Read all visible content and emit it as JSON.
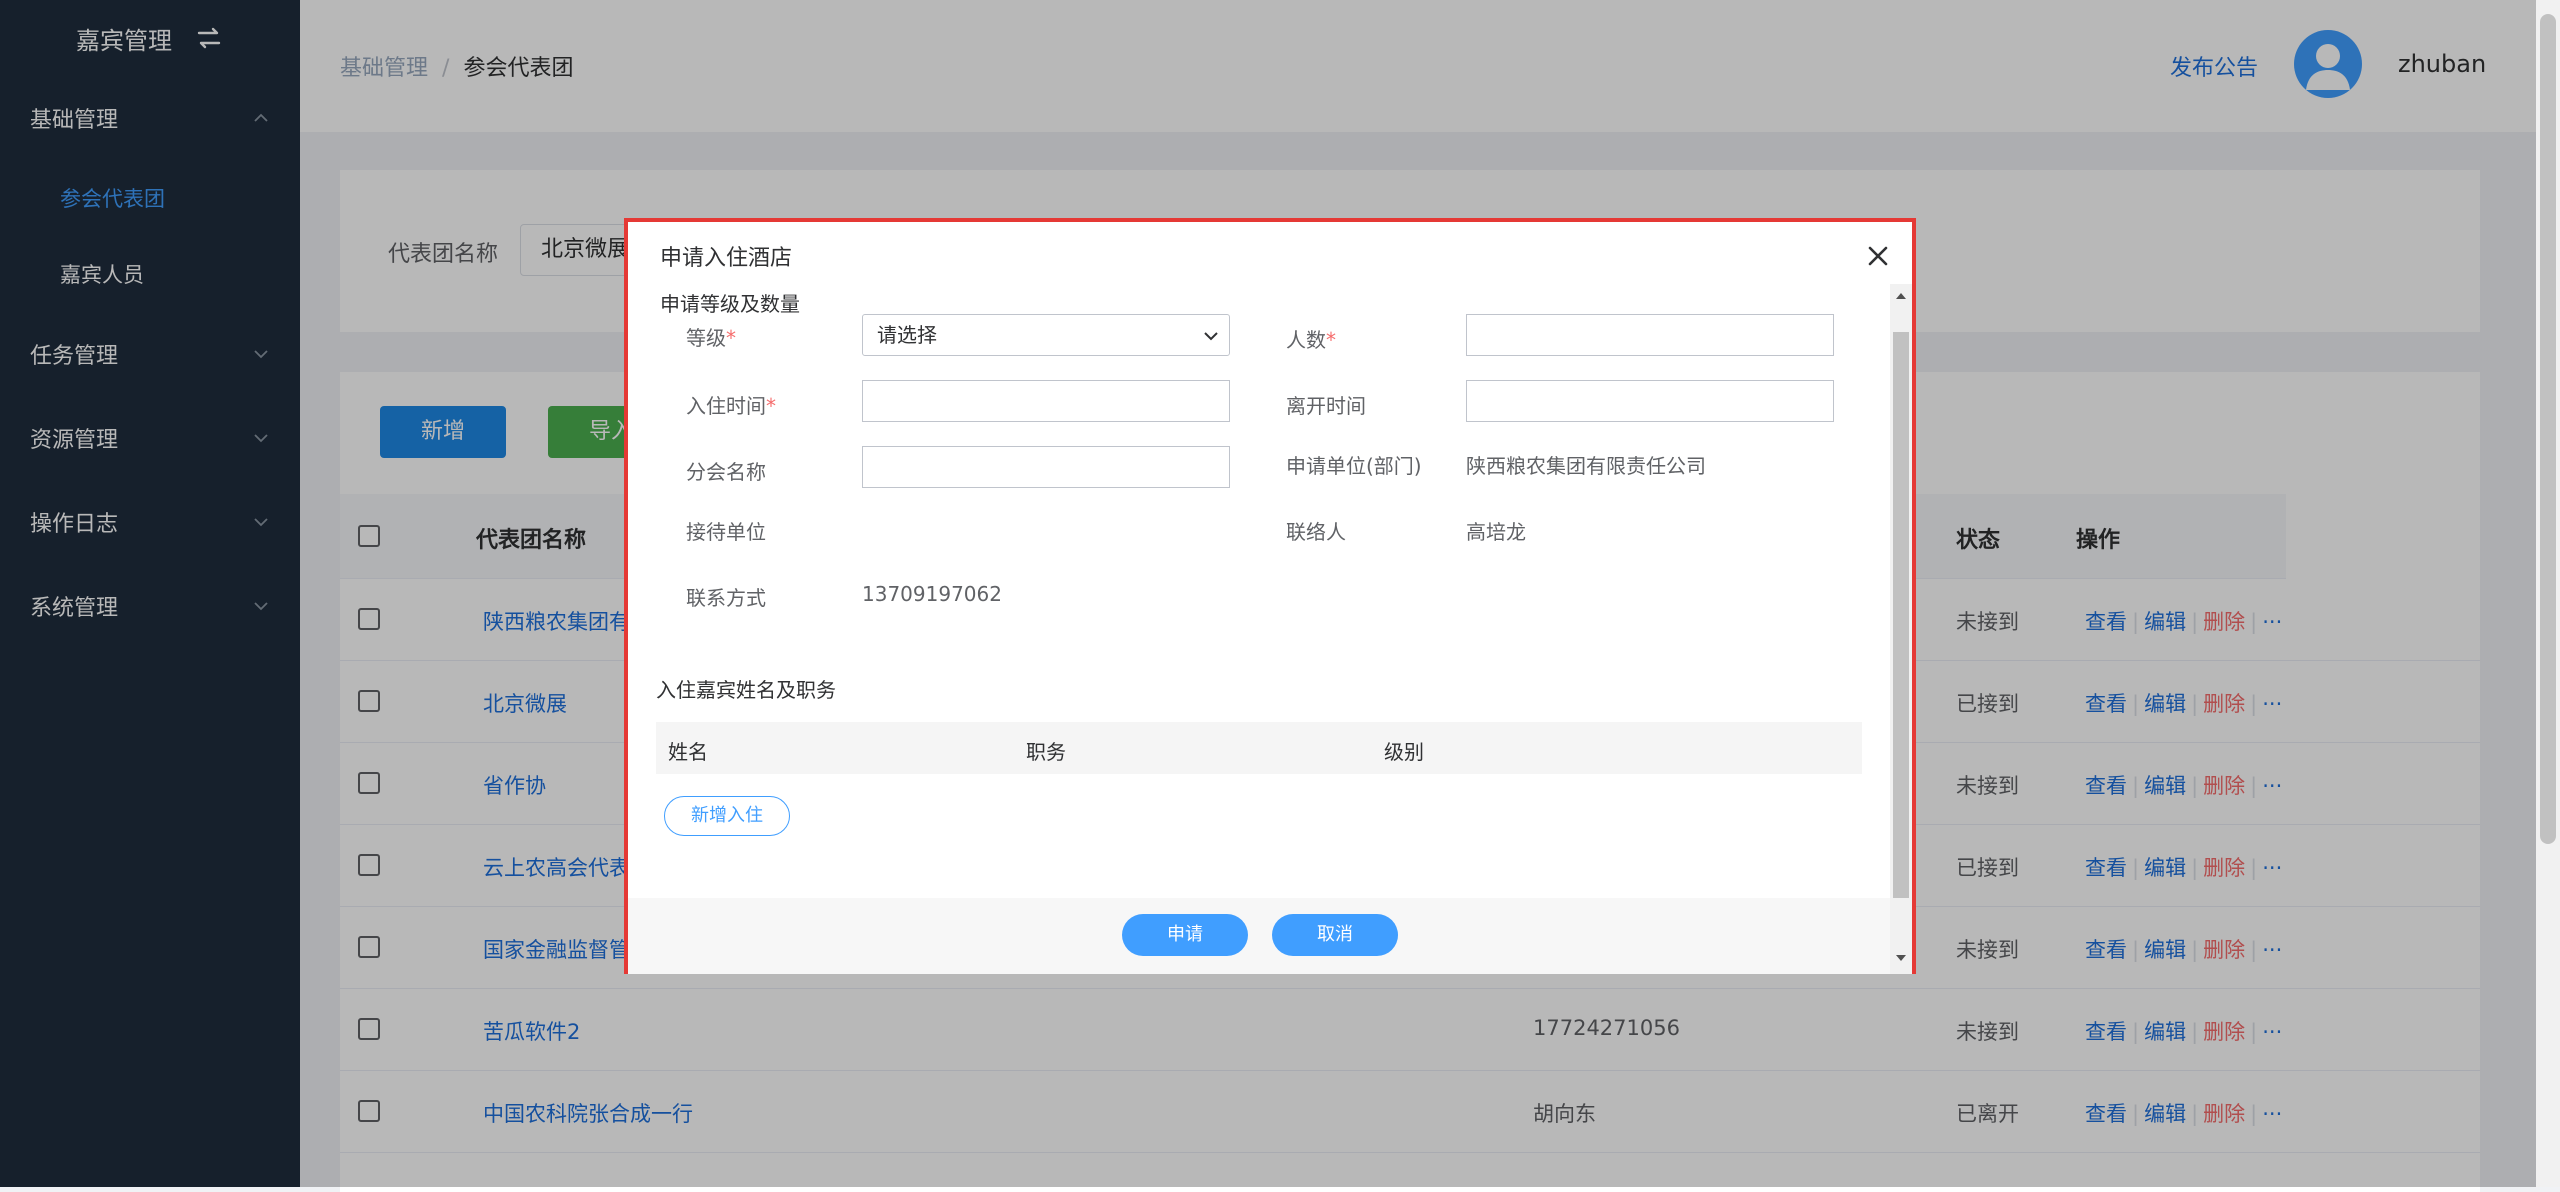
{
  "sidebar": {
    "title": "嘉宾管理",
    "groups": [
      {
        "label": "基础管理",
        "expanded": true,
        "items": [
          {
            "label": "参会代表团",
            "active": true
          },
          {
            "label": "嘉宾人员",
            "active": false
          }
        ]
      },
      {
        "label": "任务管理",
        "expanded": false
      },
      {
        "label": "资源管理",
        "expanded": false
      },
      {
        "label": "操作日志",
        "expanded": false
      },
      {
        "label": "系统管理",
        "expanded": false
      }
    ]
  },
  "header": {
    "breadcrumb": [
      "基础管理",
      "参会代表团"
    ],
    "breadcrumb_sep": "/",
    "publish_link": "发布公告",
    "username": "zhuban"
  },
  "filter": {
    "label": "代表团名称",
    "value": "北京微展"
  },
  "toolbar": {
    "add_label": "新增",
    "import_label": "导入"
  },
  "table": {
    "columns": {
      "name": "代表团名称",
      "status": "状态",
      "ops": "操作"
    },
    "rows": [
      {
        "name": "陕西粮农集团有",
        "contact": "",
        "status": "未接到"
      },
      {
        "name": "北京微展",
        "contact": "",
        "status": "已接到"
      },
      {
        "name": "省作协",
        "contact": "",
        "status": "未接到"
      },
      {
        "name": "云上农高会代表",
        "contact": "",
        "status": "已接到"
      },
      {
        "name": "国家金融监督管",
        "contact": "",
        "status": "未接到"
      },
      {
        "name": "苦瓜软件2",
        "contact": "17724271056",
        "status": "未接到"
      },
      {
        "name": "中国农科院张合成一行",
        "contact": "胡向东",
        "status": "已离开"
      }
    ],
    "row_actions": {
      "view": "查看",
      "edit": "编辑",
      "delete": "删除",
      "more": "···"
    }
  },
  "dialog": {
    "title": "申请入住酒店",
    "section_title": "申请等级及数量",
    "fields": {
      "level_label": "等级",
      "level_placeholder": "请选择",
      "people_label": "人数",
      "checkin_label": "入住时间",
      "leave_label": "离开时间",
      "branch_label": "分会名称",
      "apply_unit_label": "申请单位(部门)",
      "apply_unit_value": "陕西粮农集团有限责任公司",
      "reception_label": "接待单位",
      "liaison_label": "联络人",
      "liaison_value": "高培龙",
      "contact_label": "联系方式",
      "contact_value": "13709197062"
    },
    "required_mark": "*",
    "guest_section_title": "入住嘉宾姓名及职务",
    "guest_columns": [
      "姓名",
      "职务",
      "级别"
    ],
    "new_checkin_label": "新增入住",
    "submit_label": "申请",
    "cancel_label": "取消"
  },
  "colors": {
    "sidebar_bg": "#1f2d3d",
    "primary": "#409eff",
    "danger": "#f56c6c",
    "dialog_border": "#e53935"
  }
}
